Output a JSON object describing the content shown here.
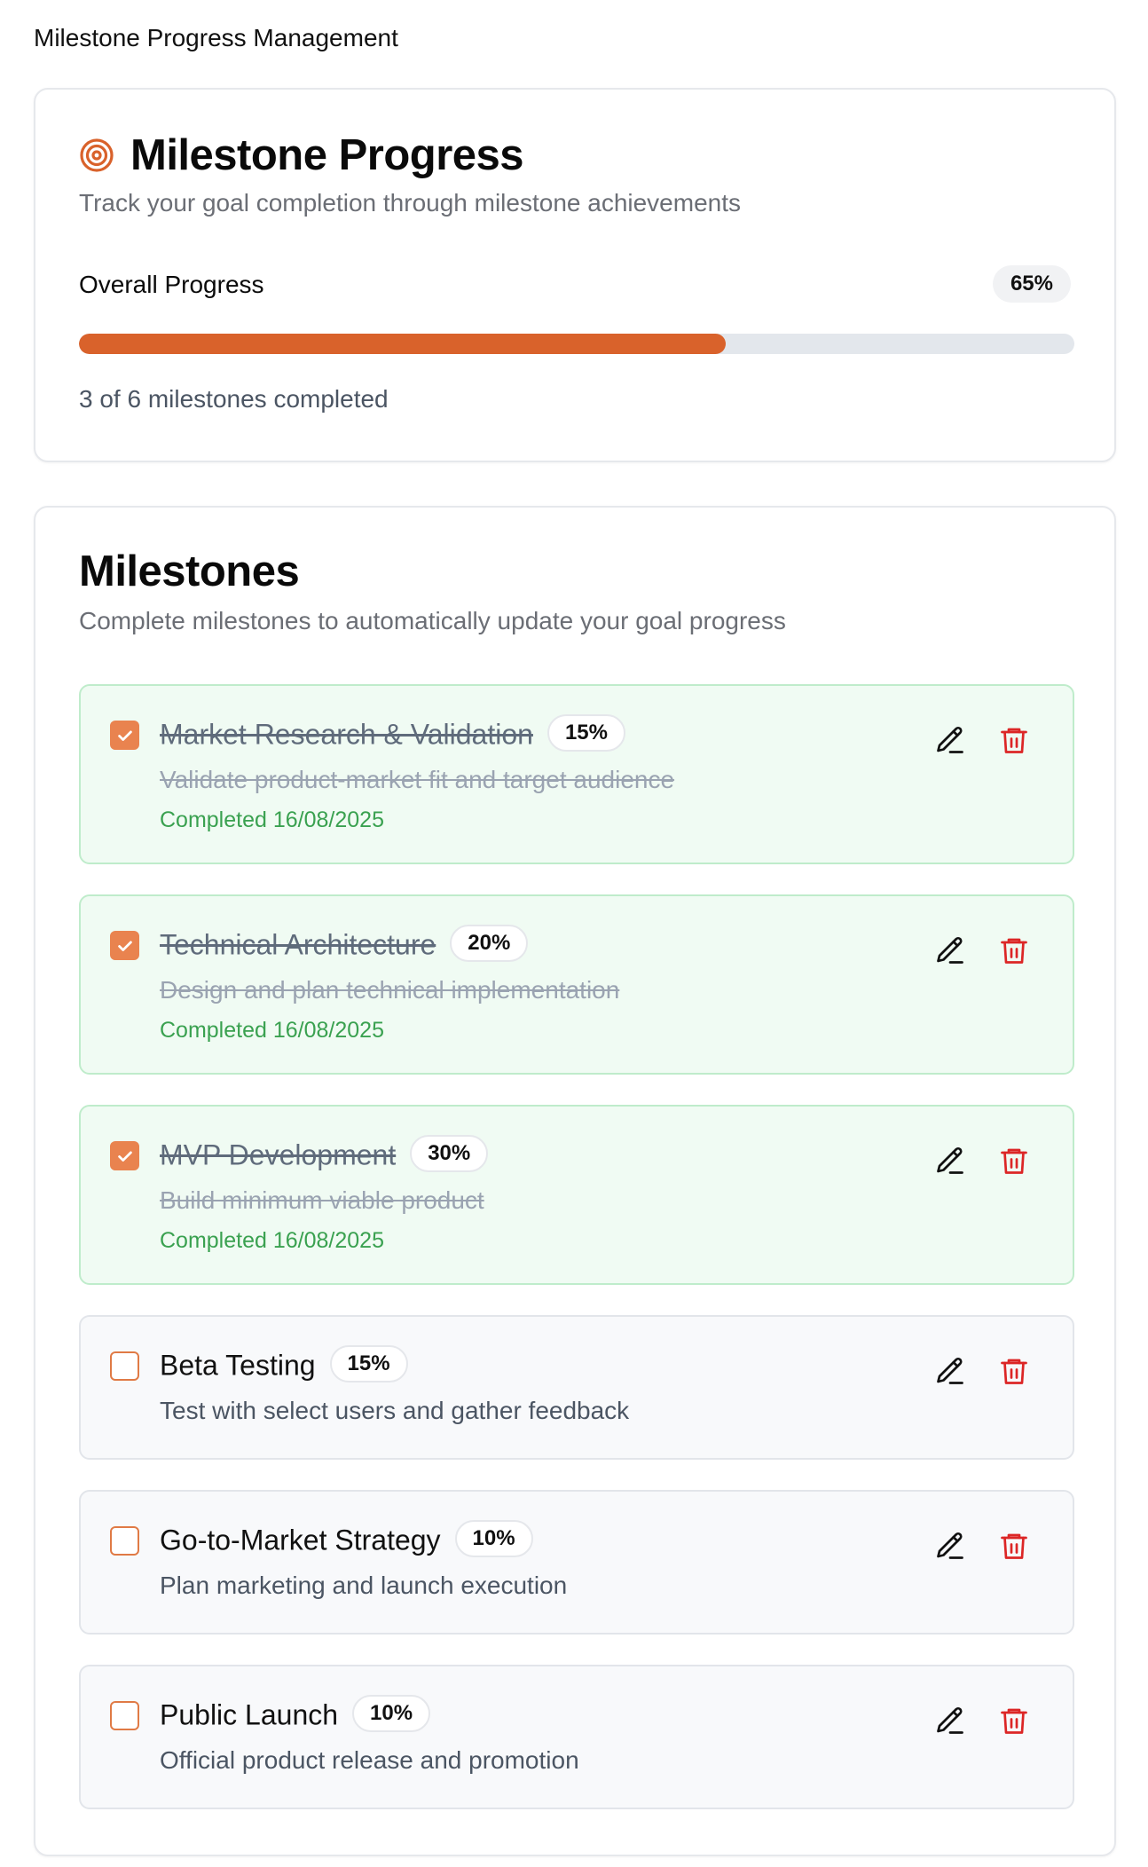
{
  "page": {
    "title": "Milestone Progress Management"
  },
  "progress_card": {
    "title": "Milestone Progress",
    "subtitle": "Track your goal completion through milestone achievements",
    "overall_label": "Overall Progress",
    "overall_percent_label": "65%",
    "overall_percent": 65,
    "summary": "3 of 6 milestones completed",
    "colors": {
      "accent": "#d9622b",
      "track": "#e3e7ec"
    }
  },
  "milestones_card": {
    "title": "Milestones",
    "subtitle": "Complete milestones to automatically update your goal progress",
    "items": [
      {
        "title": "Market Research & Validation",
        "weight": "15%",
        "description": "Validate product-market fit and target audience",
        "completed": true,
        "completed_text": "Completed 16/08/2025"
      },
      {
        "title": "Technical Architecture",
        "weight": "20%",
        "description": "Design and plan technical implementation",
        "completed": true,
        "completed_text": "Completed 16/08/2025"
      },
      {
        "title": "MVP Development",
        "weight": "30%",
        "description": "Build minimum viable product",
        "completed": true,
        "completed_text": "Completed 16/08/2025"
      },
      {
        "title": "Beta Testing",
        "weight": "15%",
        "description": "Test with select users and gather feedback",
        "completed": false
      },
      {
        "title": "Go-to-Market Strategy",
        "weight": "10%",
        "description": "Plan marketing and launch execution",
        "completed": false
      },
      {
        "title": "Public Launch",
        "weight": "10%",
        "description": "Official product release and promotion",
        "completed": false
      }
    ],
    "icons": {
      "edit": "pencil-icon",
      "delete": "trash-icon",
      "check": "check-icon",
      "header": "target-icon"
    },
    "colors": {
      "done_bg": "#f0fbf3",
      "done_border": "#bfeccb",
      "completed_text": "#3aa150",
      "delete": "#dc2626",
      "checkbox": "#e9834f"
    }
  }
}
